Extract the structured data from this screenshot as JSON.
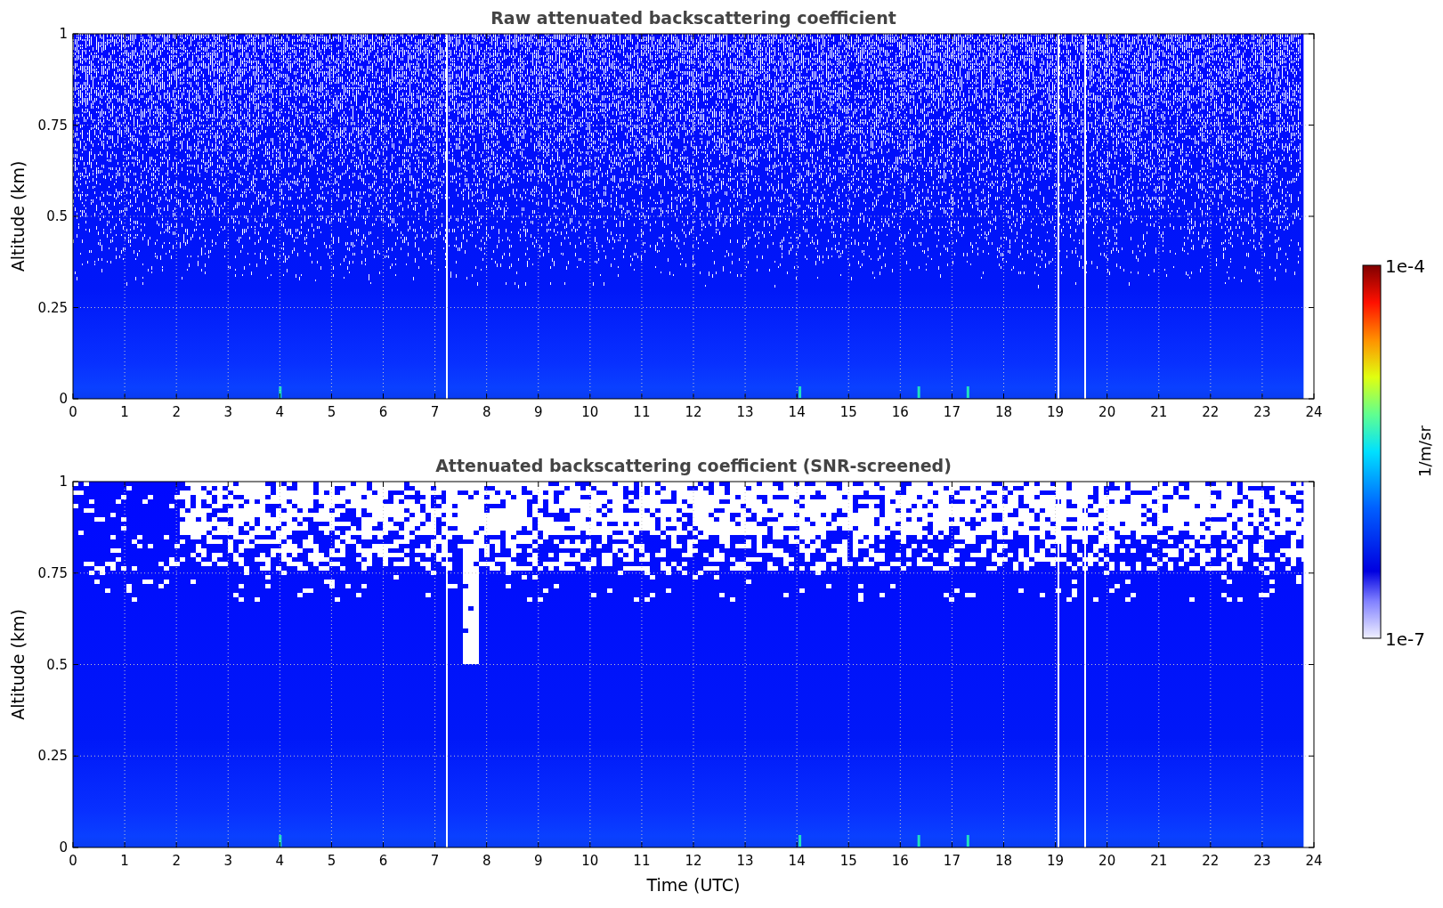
{
  "panels": [
    {
      "kind": "raw",
      "title": "Raw attenuated backscattering coefficient",
      "ylabel": "Altitude (km)",
      "yticks": [
        "1",
        "0.75",
        "0.5",
        "0.25",
        "0"
      ],
      "xticks": [
        "0",
        "1",
        "2",
        "3",
        "4",
        "5",
        "6",
        "7",
        "8",
        "9",
        "10",
        "11",
        "12",
        "13",
        "14",
        "15",
        "16",
        "17",
        "18",
        "19",
        "20",
        "21",
        "22",
        "23",
        "24"
      ]
    },
    {
      "kind": "screened",
      "title": "Attenuated backscattering coefficient (SNR-screened)",
      "ylabel": "Altitude (km)",
      "yticks": [
        "1",
        "0.75",
        "0.5",
        "0.25",
        "0"
      ],
      "xticks": [
        "0",
        "1",
        "2",
        "3",
        "4",
        "5",
        "6",
        "7",
        "8",
        "9",
        "10",
        "11",
        "12",
        "13",
        "14",
        "15",
        "16",
        "17",
        "18",
        "19",
        "20",
        "21",
        "22",
        "23",
        "24"
      ],
      "xlabel": "Time (UTC)"
    }
  ],
  "colorbar": {
    "max_label": "1e-4",
    "min_label": "1e-7",
    "label": "1/m/sr"
  }
}
